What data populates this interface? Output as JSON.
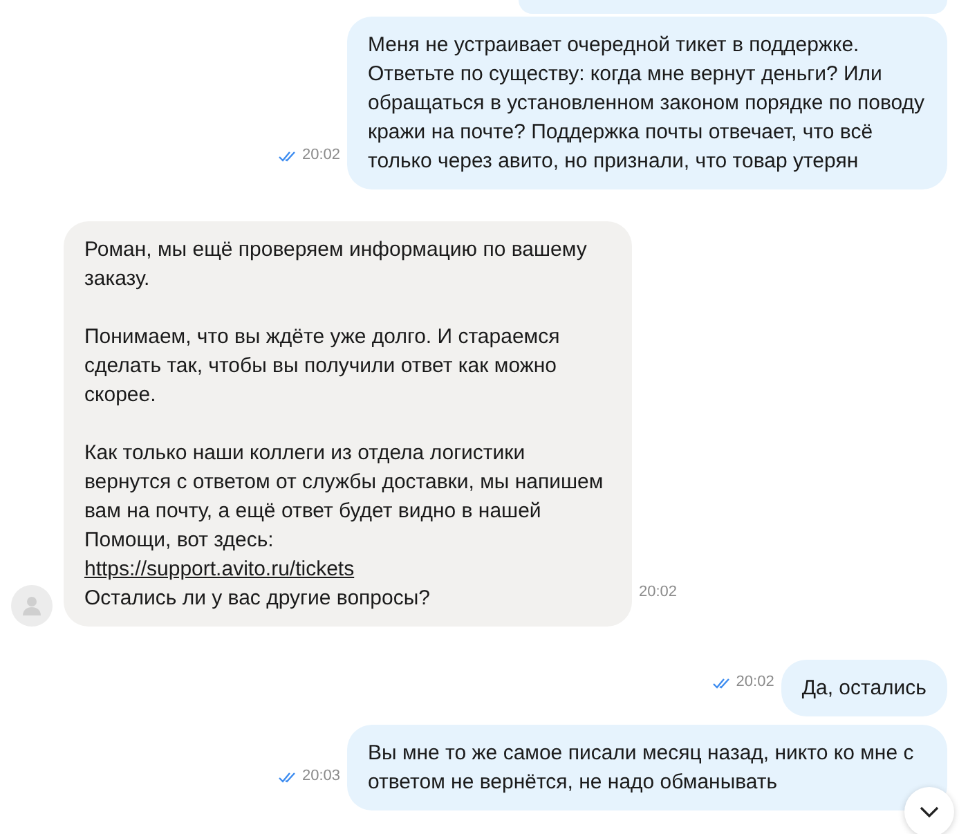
{
  "messages": [
    {
      "kind": "outgoing",
      "cut": true
    },
    {
      "kind": "outgoing",
      "text": "Меня не устраивает очередной тикет в поддержке. Ответьте по существу: когда мне вернут деньги? Или обращаться в установленном законом порядке по поводу кражи на почте? Поддержка почты отвечает, что всё только через авито, но признали, что товар утерян",
      "time": "20:02",
      "read": true
    },
    {
      "kind": "incoming",
      "paragraphs": [
        "Роман, мы ещё проверяем информацию по вашему заказу.",
        "Понимаем, что вы ждёте уже долго. И стараемся сделать так, чтобы вы получили ответ как можно скорее.",
        "Как только наши коллеги из отдела логистики вернутся с ответом от службы доставки, мы напишем вам на почту, а ещё ответ будет видно в нашей Помощи, вот здесь:"
      ],
      "link": "https://support.avito.ru/tickets",
      "closing": "Остались ли у вас другие вопросы?",
      "time": "20:02"
    },
    {
      "kind": "outgoing",
      "text": "Да, остались",
      "time": "20:02",
      "read": true
    },
    {
      "kind": "outgoing",
      "text": "Вы мне то же самое писали месяц назад, никто ко мне с ответом не вернётся, не надо обманывать",
      "time": "20:03",
      "read": true
    }
  ]
}
